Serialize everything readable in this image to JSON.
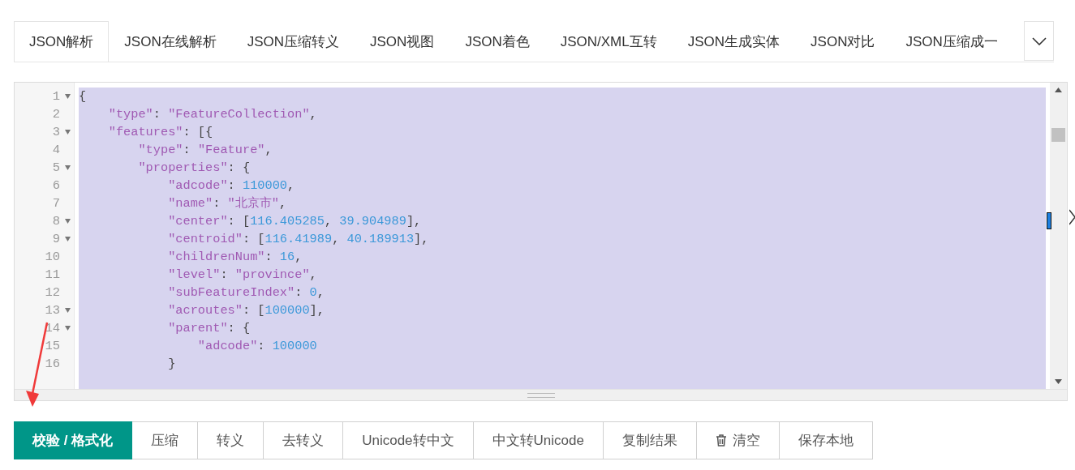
{
  "tabs": [
    {
      "label": "JSON解析",
      "selected": true
    },
    {
      "label": "JSON在线解析",
      "selected": false
    },
    {
      "label": "JSON压缩转义",
      "selected": false
    },
    {
      "label": "JSON视图",
      "selected": false
    },
    {
      "label": "JSON着色",
      "selected": false
    },
    {
      "label": "JSON/XML互转",
      "selected": false
    },
    {
      "label": "JSON生成实体",
      "selected": false
    },
    {
      "label": "JSON对比",
      "selected": false
    },
    {
      "label": "JSON压缩成一",
      "selected": false
    }
  ],
  "editor": {
    "selected": true,
    "lines": [
      {
        "number": "1",
        "fold": true,
        "tokens": [
          {
            "kind": "punct",
            "text": "{"
          }
        ]
      },
      {
        "number": "2",
        "fold": false,
        "tokens": [
          {
            "kind": "key",
            "text": "    \"type\""
          },
          {
            "kind": "punct",
            "text": ": "
          },
          {
            "kind": "string",
            "text": "\"FeatureCollection\""
          },
          {
            "kind": "punct",
            "text": ","
          }
        ]
      },
      {
        "number": "3",
        "fold": true,
        "tokens": [
          {
            "kind": "key",
            "text": "    \"features\""
          },
          {
            "kind": "punct",
            "text": ": [{"
          }
        ]
      },
      {
        "number": "4",
        "fold": false,
        "tokens": [
          {
            "kind": "key",
            "text": "        \"type\""
          },
          {
            "kind": "punct",
            "text": ": "
          },
          {
            "kind": "string",
            "text": "\"Feature\""
          },
          {
            "kind": "punct",
            "text": ","
          }
        ]
      },
      {
        "number": "5",
        "fold": true,
        "tokens": [
          {
            "kind": "key",
            "text": "        \"properties\""
          },
          {
            "kind": "punct",
            "text": ": {"
          }
        ]
      },
      {
        "number": "6",
        "fold": false,
        "tokens": [
          {
            "kind": "key",
            "text": "            \"adcode\""
          },
          {
            "kind": "punct",
            "text": ": "
          },
          {
            "kind": "number",
            "text": "110000"
          },
          {
            "kind": "punct",
            "text": ","
          }
        ]
      },
      {
        "number": "7",
        "fold": false,
        "tokens": [
          {
            "kind": "key",
            "text": "            \"name\""
          },
          {
            "kind": "punct",
            "text": ": "
          },
          {
            "kind": "string",
            "text": "\"北京市\""
          },
          {
            "kind": "punct",
            "text": ","
          }
        ]
      },
      {
        "number": "8",
        "fold": true,
        "tokens": [
          {
            "kind": "key",
            "text": "            \"center\""
          },
          {
            "kind": "punct",
            "text": ": ["
          },
          {
            "kind": "number",
            "text": "116.405285"
          },
          {
            "kind": "punct",
            "text": ", "
          },
          {
            "kind": "number",
            "text": "39.904989"
          },
          {
            "kind": "punct",
            "text": "],"
          }
        ]
      },
      {
        "number": "9",
        "fold": true,
        "tokens": [
          {
            "kind": "key",
            "text": "            \"centroid\""
          },
          {
            "kind": "punct",
            "text": ": ["
          },
          {
            "kind": "number",
            "text": "116.41989"
          },
          {
            "kind": "punct",
            "text": ", "
          },
          {
            "kind": "number",
            "text": "40.189913"
          },
          {
            "kind": "punct",
            "text": "],"
          }
        ]
      },
      {
        "number": "10",
        "fold": false,
        "tokens": [
          {
            "kind": "key",
            "text": "            \"childrenNum\""
          },
          {
            "kind": "punct",
            "text": ": "
          },
          {
            "kind": "number",
            "text": "16"
          },
          {
            "kind": "punct",
            "text": ","
          }
        ]
      },
      {
        "number": "11",
        "fold": false,
        "tokens": [
          {
            "kind": "key",
            "text": "            \"level\""
          },
          {
            "kind": "punct",
            "text": ": "
          },
          {
            "kind": "string",
            "text": "\"province\""
          },
          {
            "kind": "punct",
            "text": ","
          }
        ]
      },
      {
        "number": "12",
        "fold": false,
        "tokens": [
          {
            "kind": "key",
            "text": "            \"subFeatureIndex\""
          },
          {
            "kind": "punct",
            "text": ": "
          },
          {
            "kind": "number",
            "text": "0"
          },
          {
            "kind": "punct",
            "text": ","
          }
        ]
      },
      {
        "number": "13",
        "fold": true,
        "tokens": [
          {
            "kind": "key",
            "text": "            \"acroutes\""
          },
          {
            "kind": "punct",
            "text": ": ["
          },
          {
            "kind": "number",
            "text": "100000"
          },
          {
            "kind": "punct",
            "text": "],"
          }
        ]
      },
      {
        "number": "14",
        "fold": true,
        "tokens": [
          {
            "kind": "key",
            "text": "            \"parent\""
          },
          {
            "kind": "punct",
            "text": ": {"
          }
        ]
      },
      {
        "number": "15",
        "fold": false,
        "tokens": [
          {
            "kind": "key",
            "text": "                \"adcode\""
          },
          {
            "kind": "punct",
            "text": ": "
          },
          {
            "kind": "number",
            "text": "100000"
          }
        ]
      },
      {
        "number": "16",
        "fold": false,
        "tokens": [
          {
            "kind": "punct",
            "text": "            }"
          }
        ]
      }
    ]
  },
  "buttons": [
    {
      "label": "校验 / 格式化",
      "kind": "primary"
    },
    {
      "label": "压缩",
      "kind": "plain"
    },
    {
      "label": "转义",
      "kind": "plain"
    },
    {
      "label": "去转义",
      "kind": "plain"
    },
    {
      "label": "Unicode转中文",
      "kind": "plain"
    },
    {
      "label": "中文转Unicode",
      "kind": "plain"
    },
    {
      "label": "复制结果",
      "kind": "plain"
    },
    {
      "label": "清空",
      "kind": "trash"
    },
    {
      "label": "保存本地",
      "kind": "plain"
    }
  ]
}
